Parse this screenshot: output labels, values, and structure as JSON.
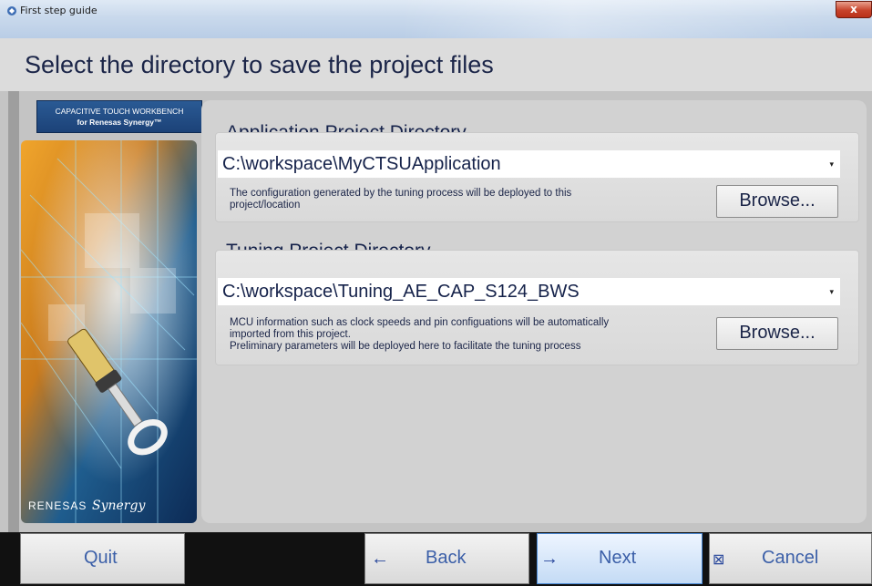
{
  "window": {
    "title": "First step guide",
    "close_glyph": "x"
  },
  "header": {
    "title": "Select the directory to save the project files"
  },
  "branding": {
    "line1": "CAPACITIVE TOUCH WORKBENCH",
    "line2": "for Renesas Synergy™",
    "footer_renesas": "RENESAS",
    "footer_synergy": "Synergy"
  },
  "application": {
    "title": "Application Project Directory",
    "path": "C:\\workspace\\MyCTSUApplication",
    "desc_line1": "The configuration generated by the tuning process will be deployed to this",
    "desc_line2": "project/location",
    "browse_label": "Browse..."
  },
  "tuning": {
    "title": "Tuning Project Directory",
    "path": "C:\\workspace\\Tuning_AE_CAP_S124_BWS",
    "desc_line1": "MCU information such as clock speeds and pin configuations will be automatically",
    "desc_line2": "imported from this project.",
    "desc_line3": "Preliminary parameters will be deployed here to facilitate the tuning process",
    "browse_label": "Browse..."
  },
  "footer": {
    "quit": "Quit",
    "back": "Back",
    "next": "Next",
    "cancel": "Cancel",
    "back_icon": "←",
    "next_icon": "→",
    "cancel_icon": "⊠"
  },
  "colors": {
    "accent": "#3b5fa8",
    "title_text": "#1b2548",
    "next_highlight": "#4b8ad6"
  }
}
